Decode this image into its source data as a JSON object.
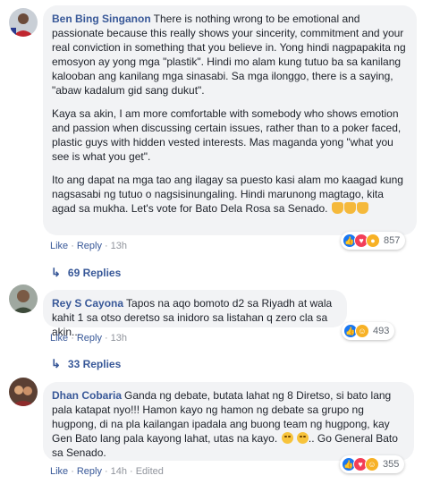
{
  "comments": [
    {
      "author": "Ben Bing Singanon",
      "paragraphs": [
        "There is nothing wrong to be emotional and passionate because this really shows your sincerity, commitment and your real conviction in something that you believe in. Yong hindi nagpapakita ng emosyon ay yong mga \"plastik\". Hindi mo alam kung tutuo ba sa kanilang kalooban ang kanilang mga sinasabi. Sa mga ilonggo, there is a saying, \"abaw kadalum gid sang dukut\".",
        "Kaya sa akin, I am more comfortable with somebody who shows emotion and passion when discussing certain issues, rather than to a poker faced, plastic guys with hidden vested interests. Mas maganda yong \"what you see is what you get\".",
        "Ito ang dapat na mga tao ang ilagay sa puesto kasi alam mo kaagad kung nagsasabi ng tutuo o nagsisinungaling. Hindi marunong magtago, kita agad sa mukha. Let's vote for Bato Dela Rosa sa Senado."
      ],
      "end_emojis": [
        "clapping-hands",
        "clapping-hands",
        "clapping-hands"
      ],
      "like_label": "Like",
      "reply_label": "Reply",
      "time": "13h",
      "reactions": [
        "like",
        "love",
        "wow"
      ],
      "reaction_count": "857",
      "replies_label": "69 Replies"
    },
    {
      "author": "Rey S Cayona",
      "text": "Tapos na aqo bomoto d2 sa Riyadh at wala kahit 1 sa otso deretso sa inidoro sa listahan q zero cla sa akin...",
      "like_label": "Like",
      "reply_label": "Reply",
      "time": "13h",
      "reactions": [
        "like",
        "haha"
      ],
      "reaction_count": "493",
      "replies_label": "33 Replies"
    },
    {
      "author": "Dhan Cobaria",
      "text": "Ganda ng debate, butata lahat ng 8 Diretso, si bato lang pala katapat nyo!!! Hamon kayo ng hamon ng debate sa grupo ng hugpong, di na pla kailangan ipadala ang buong team ng hugpong, kay Gen Bato lang pala kayong lahat, utas na kayo.",
      "text_end": ".. Go General Bato sa Senado.",
      "like_label": "Like",
      "reply_label": "Reply",
      "time": "14h",
      "edited_label": "Edited",
      "reactions": [
        "like",
        "love",
        "haha"
      ],
      "reaction_count": "355"
    }
  ],
  "colors": {
    "link": "#385898",
    "bubble": "#f2f3f5",
    "like": "#1877f2",
    "love": "#f33e58",
    "wow": "#f7b125"
  }
}
